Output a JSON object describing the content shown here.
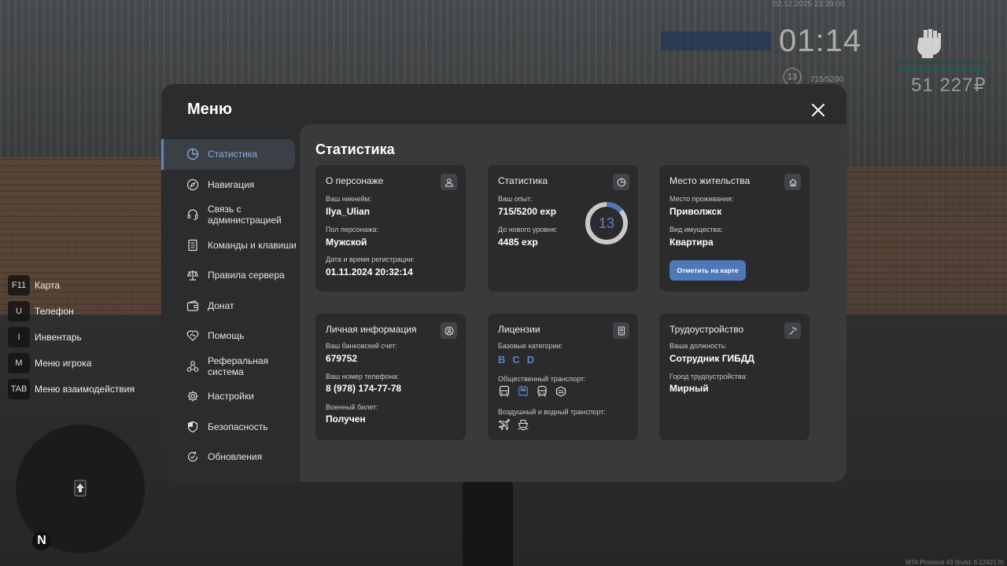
{
  "hud": {
    "datetime": "02.12.2025 23:39:00",
    "clock": "01:14",
    "level": "13",
    "exp": "715/5200",
    "money": "51 227₽",
    "build": "MTA Province #3 (build: 6.12421.9)",
    "colors": {
      "bar_top": "#2e4a46",
      "bar_bottom": "#1f5b52"
    }
  },
  "hotkeys": [
    {
      "key": "F11",
      "label": "Карта"
    },
    {
      "key": "U",
      "label": "Телефон"
    },
    {
      "key": "I",
      "label": "Инвентарь"
    },
    {
      "key": "M",
      "label": "Меню игрока"
    },
    {
      "key": "TAB",
      "label": "Меню взаимодействия"
    }
  ],
  "minimap": {
    "north": "N"
  },
  "menu": {
    "title": "Меню",
    "sidebar": [
      {
        "label": "Статистика",
        "icon": "pie-chart-icon",
        "active": true
      },
      {
        "label": "Навигация",
        "icon": "compass-icon"
      },
      {
        "label": "Связь с администрацией",
        "icon": "headset-icon"
      },
      {
        "label": "Команды и клавиши",
        "icon": "document-icon"
      },
      {
        "label": "Правила сервера",
        "icon": "scales-icon"
      },
      {
        "label": "Донат",
        "icon": "wallet-icon"
      },
      {
        "label": "Помощь",
        "icon": "handshake-icon"
      },
      {
        "label": "Реферальная система",
        "icon": "network-icon"
      },
      {
        "label": "Настройки",
        "icon": "gear-icon"
      },
      {
        "label": "Безопасность",
        "icon": "shield-icon"
      },
      {
        "label": "Обновления",
        "icon": "refresh-check-icon"
      }
    ]
  },
  "content": {
    "title": "Статистика",
    "character": {
      "title": "О персонаже",
      "nickname_label": "Ваш никнейм:",
      "nickname": "Ilya_Ulian",
      "gender_label": "Пол персонажа:",
      "gender": "Мужской",
      "reg_label": "Дата и время регистрации:",
      "reg": "01.11.2024 20:32:14"
    },
    "stats": {
      "title": "Статистика",
      "exp_label": "Ваш опыт:",
      "exp": "715/5200 exp",
      "next_label": "До нового уровня:",
      "next": "4485 exp",
      "level": "13",
      "progress": 0.1375
    },
    "residence": {
      "title": "Место жительства",
      "place_label": "Место проживания:",
      "place": "Приволжск",
      "property_label": "Вид имущества:",
      "property": "Квартира",
      "map_button": "Отметить на карте"
    },
    "personal": {
      "title": "Личная информация",
      "bank_label": "Ваш банковский счет:",
      "bank": "679752",
      "phone_label": "Ваш номер телефона:",
      "phone": "8 (978) 174-77-78",
      "military_label": "Военный билет:",
      "military": "Получен"
    },
    "licenses": {
      "title": "Лицензии",
      "base_label": "Базовые категории:",
      "categories": [
        "B",
        "C",
        "D"
      ],
      "public_label": "Общественный транспорт:",
      "air_label": "Воздушный и водный транспорт:"
    },
    "employment": {
      "title": "Трудоустройство",
      "position_label": "Ваша должность:",
      "position": "Сотрудник ГИБДД",
      "city_label": "Город трудоустройства:",
      "city": "Мирный"
    }
  },
  "colors": {
    "accent": "#5b84c4",
    "button": "#4f78b8",
    "panel": "#2b2c2e",
    "content": "#3a3a3b",
    "card": "#2b2b2c"
  }
}
